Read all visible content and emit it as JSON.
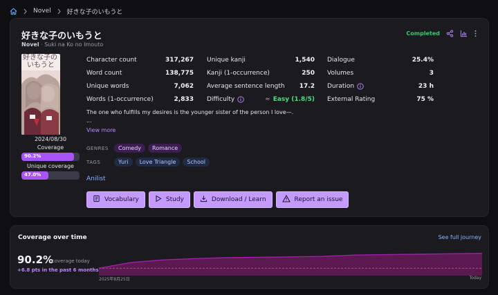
{
  "breadcrumb": {
    "home_icon": "home-icon",
    "section": "Novel",
    "current": "好きな子のいもうと"
  },
  "novel": {
    "title": "好きな子のいもうと",
    "type": "Novel",
    "romaji": "Suki na Ko no Imouto",
    "status": "Completed",
    "release_date": "2024/08/30",
    "cover_text_line1": "好きな子の",
    "cover_text_line2": "いもうと"
  },
  "coverage": {
    "label": "Coverage",
    "value_text": "90.2%",
    "value": 90.2,
    "unique_label": "Unique coverage",
    "unique_value_text": "47.0%",
    "unique_value": 47.0
  },
  "stats": {
    "col1": [
      {
        "label": "Character count",
        "value": "317,267"
      },
      {
        "label": "Word count",
        "value": "138,775"
      },
      {
        "label": "Unique words",
        "value": "7,062"
      },
      {
        "label": "Words (1-occurrence)",
        "value": "2,833"
      }
    ],
    "col2": [
      {
        "label": "Unique kanji",
        "value": "1,540"
      },
      {
        "label": "Kanji (1-occurrence)",
        "value": "250"
      },
      {
        "label": "Average sentence length",
        "value": "17.2"
      },
      {
        "label": "Difficulty",
        "approx": "≈",
        "value": "Easy (1.8/5)"
      }
    ],
    "col3": [
      {
        "label": "Dialogue",
        "value": "25.4%"
      },
      {
        "label": "Volumes",
        "value": "3"
      },
      {
        "label": "Duration",
        "value": "23 h"
      },
      {
        "label": "External Rating",
        "value": "75 %"
      }
    ]
  },
  "description": "The one who fulfills my desires is the younger sister of the person I love—.",
  "description_more": "...",
  "view_more": "View more",
  "genres_label": "GENRES",
  "genres": [
    "Comedy",
    "Romance"
  ],
  "tags_label": "TAGS",
  "tags": [
    "Yuri",
    "Love Triangle",
    "School"
  ],
  "anilist": "Anilist",
  "buttons": {
    "vocabulary": "Vocabulary",
    "study": "Study",
    "download": "Download / Learn",
    "report": "Report an issue"
  },
  "coverage_over_time": {
    "title": "Coverage over time",
    "journey_link": "See full journey",
    "current": "90.2%",
    "current_sub": "coverage today",
    "delta": "+6.8 pts in the past 6 months",
    "x_start": "2025年8月25日",
    "x_end": "Today"
  },
  "chart_data": {
    "type": "area",
    "x": [
      "2025年8月25日",
      "",
      "",
      "",
      "",
      "",
      "",
      "",
      "",
      "",
      "",
      "",
      "Today"
    ],
    "series": [
      {
        "values": [
          83.4,
          86.0,
          87.2,
          87.8,
          88.2,
          88.4,
          88.6,
          88.8,
          89.4,
          89.6,
          89.8,
          90.0,
          90.2
        ]
      }
    ],
    "ylim": [
      80,
      92
    ],
    "grid": false,
    "accent": "#a21caf"
  },
  "colors": {
    "accent": "#a855f7",
    "status": "#2ecc71",
    "link": "#8ab4ff",
    "button": "#c49aff"
  }
}
